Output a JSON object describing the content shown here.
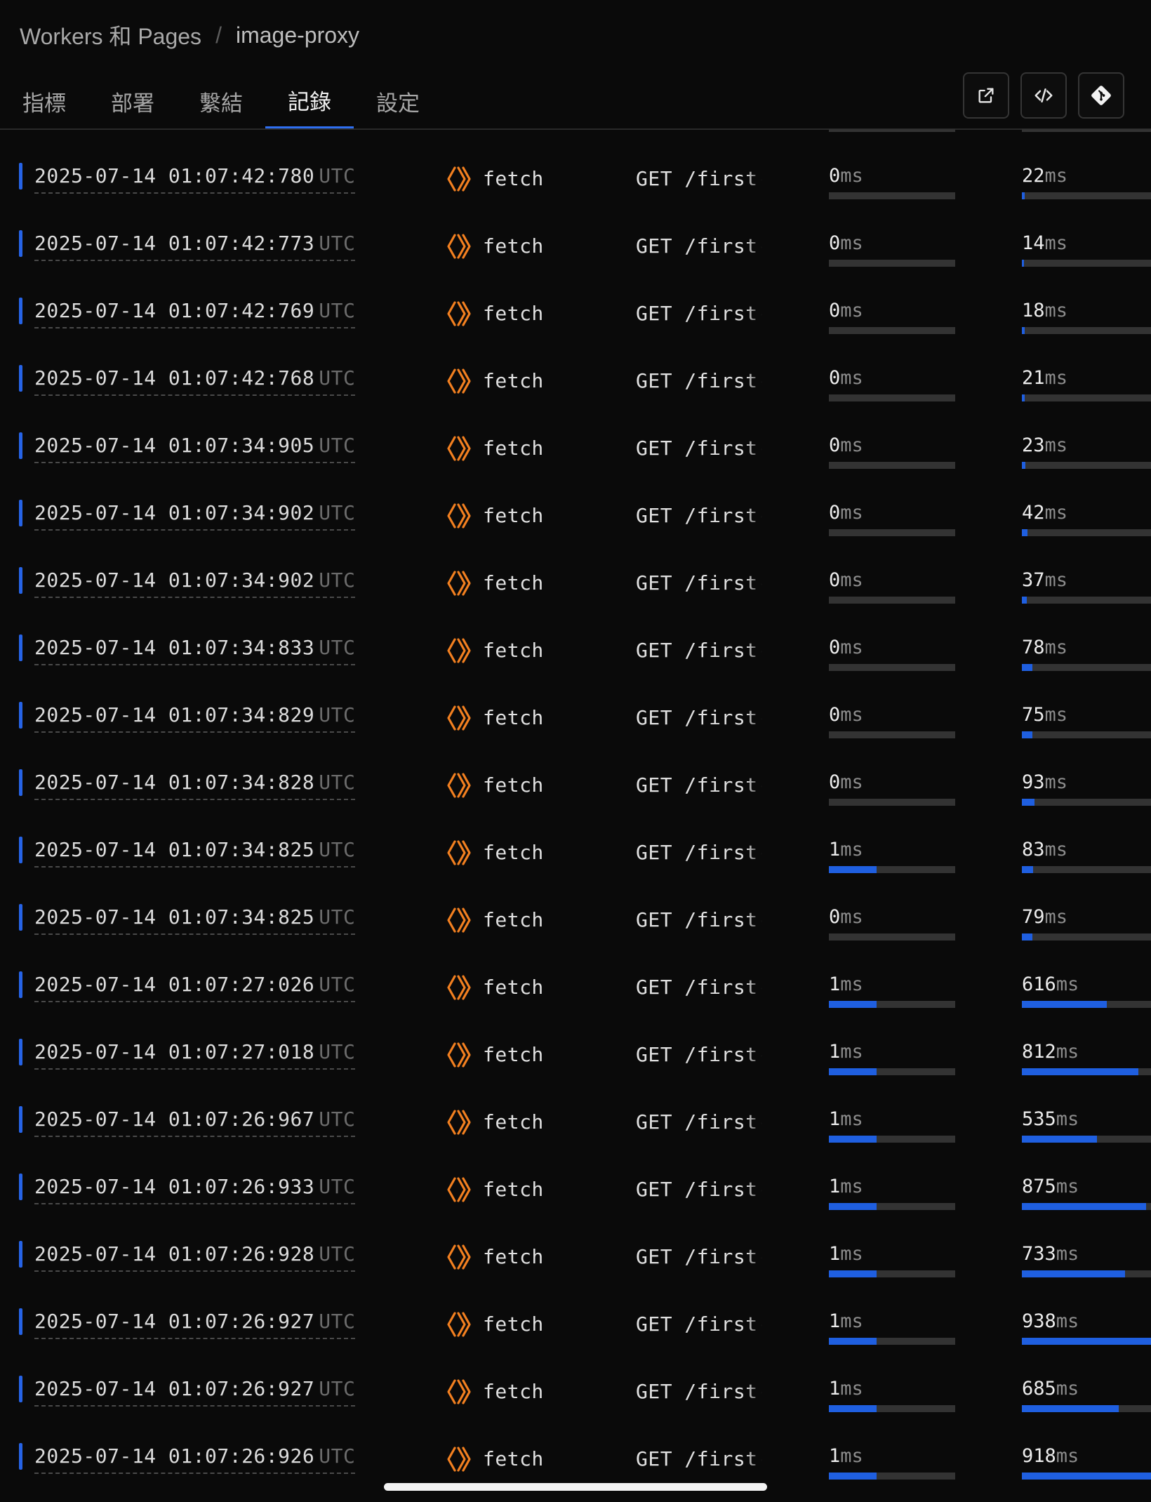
{
  "breadcrumb": {
    "parent": "Workers 和 Pages",
    "separator": "/",
    "current": "image-proxy"
  },
  "tabs": [
    {
      "label": "指標",
      "active": false
    },
    {
      "label": "部署",
      "active": false
    },
    {
      "label": "繫結",
      "active": false
    },
    {
      "label": "記錄",
      "active": true
    },
    {
      "label": "設定",
      "active": false
    }
  ],
  "toolbar": [
    {
      "icon": "external-link-icon"
    },
    {
      "icon": "code-icon"
    },
    {
      "icon": "git-icon"
    }
  ],
  "colors": {
    "accent": "#2663e6",
    "bar_fill": "#1f5fe0",
    "bar_track": "#333333",
    "fetch_icon": "#f38020"
  },
  "unit": "ms",
  "rows": [
    {
      "ts": "2025-07-14 01:07:42:780",
      "tz": "UTC",
      "type": "fetch",
      "request": "GET /first-",
      "cpu": "0",
      "cpu_fill": 0,
      "wall": "22",
      "wall_fill": 0.02
    },
    {
      "ts": "2025-07-14 01:07:42:773",
      "tz": "UTC",
      "type": "fetch",
      "request": "GET /first-",
      "cpu": "0",
      "cpu_fill": 0,
      "wall": "14",
      "wall_fill": 0.015
    },
    {
      "ts": "2025-07-14 01:07:42:769",
      "tz": "UTC",
      "type": "fetch",
      "request": "GET /first-",
      "cpu": "0",
      "cpu_fill": 0,
      "wall": "18",
      "wall_fill": 0.02
    },
    {
      "ts": "2025-07-14 01:07:42:768",
      "tz": "UTC",
      "type": "fetch",
      "request": "GET /first-",
      "cpu": "0",
      "cpu_fill": 0,
      "wall": "21",
      "wall_fill": 0.02
    },
    {
      "ts": "2025-07-14 01:07:34:905",
      "tz": "UTC",
      "type": "fetch",
      "request": "GET /first-",
      "cpu": "0",
      "cpu_fill": 0,
      "wall": "23",
      "wall_fill": 0.025
    },
    {
      "ts": "2025-07-14 01:07:34:902",
      "tz": "UTC",
      "type": "fetch",
      "request": "GET /first-",
      "cpu": "0",
      "cpu_fill": 0,
      "wall": "42",
      "wall_fill": 0.045
    },
    {
      "ts": "2025-07-14 01:07:34:902",
      "tz": "UTC",
      "type": "fetch",
      "request": "GET /first-",
      "cpu": "0",
      "cpu_fill": 0,
      "wall": "37",
      "wall_fill": 0.04
    },
    {
      "ts": "2025-07-14 01:07:34:833",
      "tz": "UTC",
      "type": "fetch",
      "request": "GET /first-",
      "cpu": "0",
      "cpu_fill": 0,
      "wall": "78",
      "wall_fill": 0.083
    },
    {
      "ts": "2025-07-14 01:07:34:829",
      "tz": "UTC",
      "type": "fetch",
      "request": "GET /first-",
      "cpu": "0",
      "cpu_fill": 0,
      "wall": "75",
      "wall_fill": 0.08
    },
    {
      "ts": "2025-07-14 01:07:34:828",
      "tz": "UTC",
      "type": "fetch",
      "request": "GET /first-",
      "cpu": "0",
      "cpu_fill": 0,
      "wall": "93",
      "wall_fill": 0.1
    },
    {
      "ts": "2025-07-14 01:07:34:825",
      "tz": "UTC",
      "type": "fetch",
      "request": "GET /first-",
      "cpu": "1",
      "cpu_fill": 0.38,
      "wall": "83",
      "wall_fill": 0.089
    },
    {
      "ts": "2025-07-14 01:07:34:825",
      "tz": "UTC",
      "type": "fetch",
      "request": "GET /first-",
      "cpu": "0",
      "cpu_fill": 0,
      "wall": "79",
      "wall_fill": 0.084
    },
    {
      "ts": "2025-07-14 01:07:27:026",
      "tz": "UTC",
      "type": "fetch",
      "request": "GET /first-",
      "cpu": "1",
      "cpu_fill": 0.38,
      "wall": "616",
      "wall_fill": 0.66
    },
    {
      "ts": "2025-07-14 01:07:27:018",
      "tz": "UTC",
      "type": "fetch",
      "request": "GET /first-",
      "cpu": "1",
      "cpu_fill": 0.38,
      "wall": "812",
      "wall_fill": 0.9
    },
    {
      "ts": "2025-07-14 01:07:26:967",
      "tz": "UTC",
      "type": "fetch",
      "request": "GET /first-",
      "cpu": "1",
      "cpu_fill": 0.38,
      "wall": "535",
      "wall_fill": 0.58
    },
    {
      "ts": "2025-07-14 01:07:26:933",
      "tz": "UTC",
      "type": "fetch",
      "request": "GET /first-",
      "cpu": "1",
      "cpu_fill": 0.38,
      "wall": "875",
      "wall_fill": 0.96
    },
    {
      "ts": "2025-07-14 01:07:26:928",
      "tz": "UTC",
      "type": "fetch",
      "request": "GET /first-",
      "cpu": "1",
      "cpu_fill": 0.38,
      "wall": "733",
      "wall_fill": 0.8
    },
    {
      "ts": "2025-07-14 01:07:26:927",
      "tz": "UTC",
      "type": "fetch",
      "request": "GET /first-",
      "cpu": "1",
      "cpu_fill": 0.38,
      "wall": "938",
      "wall_fill": 1.0
    },
    {
      "ts": "2025-07-14 01:07:26:927",
      "tz": "UTC",
      "type": "fetch",
      "request": "GET /first-",
      "cpu": "1",
      "cpu_fill": 0.38,
      "wall": "685",
      "wall_fill": 0.75
    },
    {
      "ts": "2025-07-14 01:07:26:926",
      "tz": "UTC",
      "type": "fetch",
      "request": "GET /first-",
      "cpu": "1",
      "cpu_fill": 0.38,
      "wall": "918",
      "wall_fill": 1.0
    }
  ]
}
